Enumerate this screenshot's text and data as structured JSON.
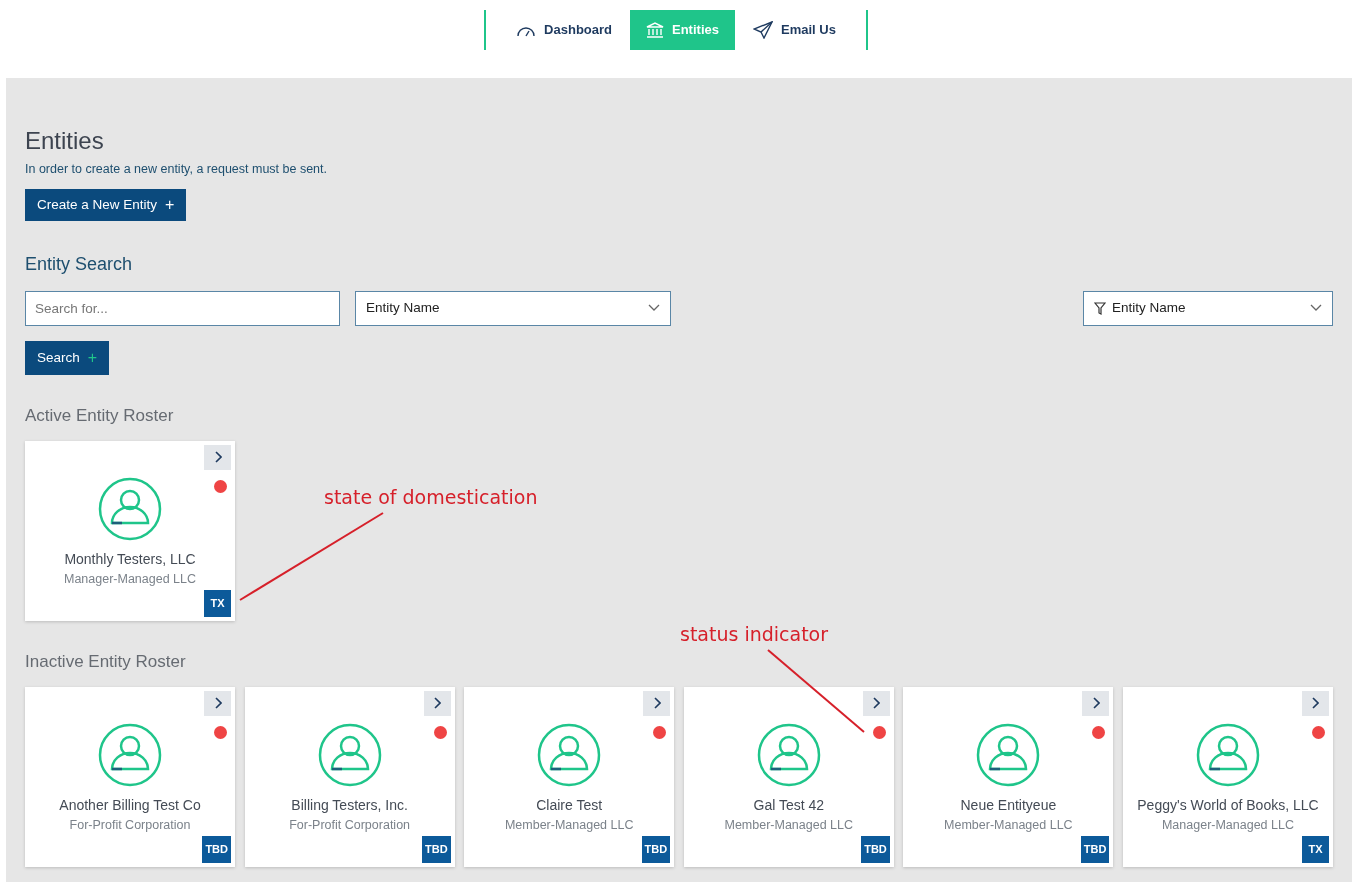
{
  "nav": {
    "tabs": [
      {
        "label": "Dashboard",
        "kind": "gauge",
        "selected": false
      },
      {
        "label": "Entities",
        "kind": "bank",
        "selected": true
      },
      {
        "label": "Email Us",
        "kind": "send",
        "selected": false
      }
    ]
  },
  "page": {
    "title": "Entities",
    "note": "In order to create a new entity, a request must be sent.",
    "create_button": "Create a New Entity",
    "plus": "+"
  },
  "search": {
    "title": "Entity Search",
    "placeholder": "Search for...",
    "field_select": "Entity Name",
    "search_button": "Search",
    "plus": "+",
    "filter_select": "Entity Name"
  },
  "rosters": [
    {
      "title": "Active Entity Roster",
      "entities": [
        {
          "name": "Monthly Testers, LLC",
          "type": "Manager-Managed LLC",
          "state": "TX",
          "color": "#ef4444"
        }
      ]
    },
    {
      "title": "Inactive Entity Roster",
      "entities": [
        {
          "name": "Another Billing Test Co",
          "type": "For-Profit Corporation",
          "state": "TBD",
          "color": "#ef4444"
        },
        {
          "name": "Billing Testers, Inc.",
          "type": "For-Profit Corporation",
          "state": "TBD",
          "color": "#ef4444"
        },
        {
          "name": "Claire Test",
          "type": "Member-Managed LLC",
          "state": "TBD",
          "color": "#ef4444"
        },
        {
          "name": "Gal Test 42",
          "type": "Member-Managed LLC",
          "state": "TBD",
          "color": "#ef4444"
        },
        {
          "name": "Neue Entityeue",
          "type": "Member-Managed LLC",
          "state": "TBD",
          "color": "#ef4444"
        },
        {
          "name": "Peggy's World of Books, LLC",
          "type": "Manager-Managed LLC",
          "state": "TX",
          "color": "#ef4444"
        }
      ]
    }
  ],
  "annotations": [
    {
      "text": "state of domestication"
    },
    {
      "text": "status indicator"
    }
  ]
}
